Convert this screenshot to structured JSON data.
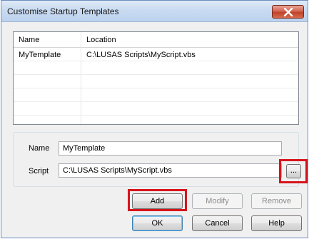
{
  "dialog": {
    "title": "Customise Startup Templates",
    "close_icon": "close-x-icon",
    "close_color": "#c7452f"
  },
  "list": {
    "headers": {
      "name": "Name",
      "location": "Location"
    },
    "rows": [
      {
        "name": "MyTemplate",
        "location": "C:\\LUSAS Scripts\\MyScript.vbs"
      }
    ]
  },
  "form": {
    "name_label": "Name",
    "name_value": "MyTemplate",
    "script_label": "Script",
    "script_value": "C:\\LUSAS Scripts\\MyScript.vbs",
    "browse_label": "..."
  },
  "buttons": {
    "add": "Add",
    "modify": "Modify",
    "remove": "Remove",
    "ok": "OK",
    "cancel": "Cancel",
    "help": "Help"
  },
  "highlight_color": "#d7141c"
}
